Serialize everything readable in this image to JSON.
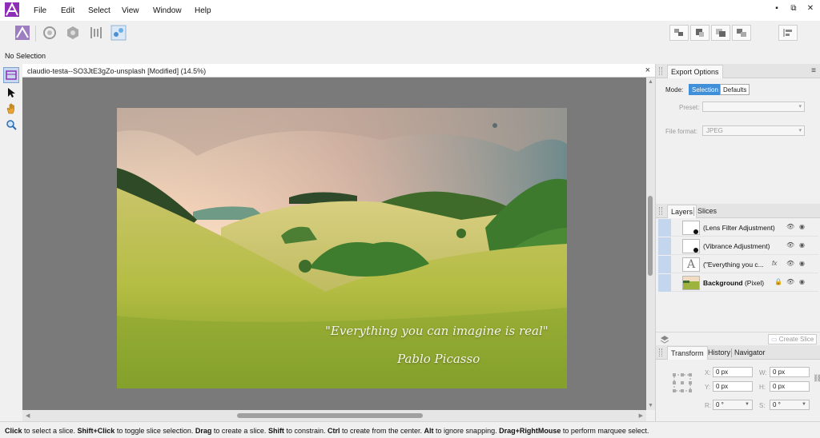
{
  "menu": [
    "File",
    "Edit",
    "Select",
    "View",
    "Window",
    "Help"
  ],
  "window_controls": {
    "minimize": "▪",
    "restore": "⧉",
    "close": "✕"
  },
  "context": {
    "label": "No Selection"
  },
  "document": {
    "tab_title": "claudio-testa--SO3JtE3gZo-unsplash [Modified] (14.5%)",
    "close": "×"
  },
  "image_text": {
    "quote": "\"Everything you can imagine is real\"",
    "author": "Pablo Picasso"
  },
  "export_options": {
    "title": "Export Options",
    "mode_label": "Mode:",
    "mode_options": [
      "Selection",
      "Defaults"
    ],
    "mode_selected": "Selection",
    "preset_label": "Preset:",
    "preset_value": "",
    "format_label": "File format:",
    "format_value": "JPEG"
  },
  "layers_panel": {
    "tabs": [
      "Layers",
      "Slices"
    ],
    "active_tab": "Layers",
    "layers": [
      {
        "name": "(Lens Filter Adjustment)",
        "kind": "adjustment"
      },
      {
        "name": "(Vibrance Adjustment)",
        "kind": "adjustment"
      },
      {
        "name": "(\"Everything you c...",
        "kind": "text"
      },
      {
        "name": "Background",
        "suffix": "(Pixel)",
        "kind": "pixel"
      }
    ],
    "create_slice_label": "Create Slice"
  },
  "transform_panel": {
    "tabs": [
      "Transform",
      "History",
      "Navigator"
    ],
    "active_tab": "Transform",
    "x_label": "X:",
    "x_value": "0 px",
    "y_label": "Y:",
    "y_value": "0 px",
    "w_label": "W:",
    "w_value": "0 px",
    "h_label": "H:",
    "h_value": "0 px",
    "r_label": "R:",
    "r_value": "0 °",
    "s_label": "S:",
    "s_value": "0 °"
  },
  "status": {
    "segments": [
      {
        "text": "Click",
        "bold": true
      },
      {
        "text": " to select a slice. ",
        "bold": false
      },
      {
        "text": "Shift+Click",
        "bold": true
      },
      {
        "text": " to toggle slice selection. ",
        "bold": false
      },
      {
        "text": "Drag",
        "bold": true
      },
      {
        "text": " to create a slice. ",
        "bold": false
      },
      {
        "text": "Shift",
        "bold": true
      },
      {
        "text": " to constrain. ",
        "bold": false
      },
      {
        "text": "Ctrl",
        "bold": true
      },
      {
        "text": " to create from the center. ",
        "bold": false
      },
      {
        "text": "Alt",
        "bold": true
      },
      {
        "text": " to ignore snapping. ",
        "bold": false
      },
      {
        "text": "Drag+RightMouse",
        "bold": true
      },
      {
        "text": " to perform marquee select.",
        "bold": false
      }
    ]
  },
  "colors": {
    "accent": "#3f8fd9",
    "selection": "#c3d6ee",
    "logo": "#8e2db8"
  }
}
